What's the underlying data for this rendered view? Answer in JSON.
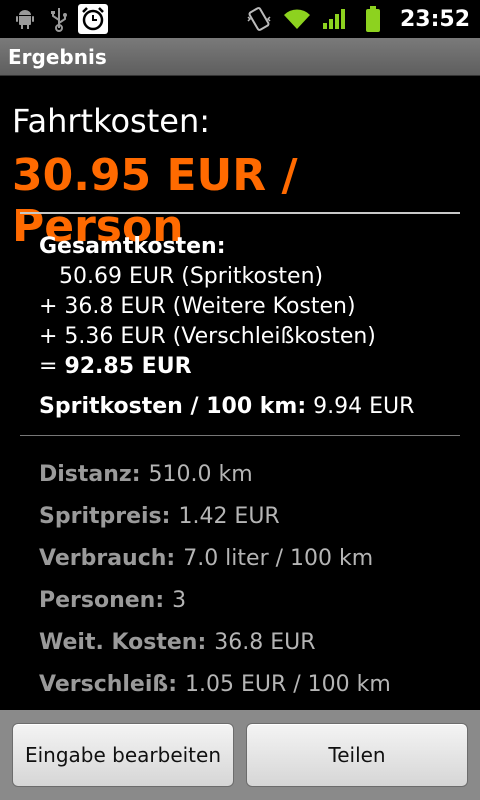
{
  "status_bar": {
    "time": "23:52",
    "icons_left": [
      "android-icon",
      "usb-icon",
      "alarm-icon"
    ],
    "icons_right": [
      "vibrate-icon",
      "wifi-icon",
      "signal-icon",
      "battery-icon"
    ]
  },
  "title_bar": {
    "title": "Ergebnis"
  },
  "summary": {
    "label": "Fahrtkosten:",
    "price": "30.95 EUR / Person"
  },
  "totals": {
    "heading": "Gesamtkosten:",
    "line1": "50.69 EUR (Spritkosten)",
    "line2": "+ 36.8 EUR (Weitere Kosten)",
    "line3": "+ 5.36 EUR (Verschleißkosten)",
    "sum_prefix": "= ",
    "sum_value": "92.85 EUR",
    "per100_label": "Spritkosten / 100 km:",
    "per100_value": "9.94 EUR"
  },
  "details": [
    {
      "label": "Distanz:",
      "value": "510.0 km"
    },
    {
      "label": "Spritpreis:",
      "value": "1.42 EUR"
    },
    {
      "label": "Verbrauch:",
      "value": "7.0 liter / 100 km"
    },
    {
      "label": "Personen:",
      "value": "3"
    },
    {
      "label": "Weit. Kosten:",
      "value": "36.8 EUR"
    },
    {
      "label": "Verschleiß:",
      "value": "1.05 EUR / 100 km"
    }
  ],
  "buttons": {
    "edit": "Eingabe bearbeiten",
    "share": "Teilen"
  },
  "colors": {
    "accent": "#ff6a00",
    "battery": "#8dd21f",
    "signal": "#8dd21f"
  }
}
